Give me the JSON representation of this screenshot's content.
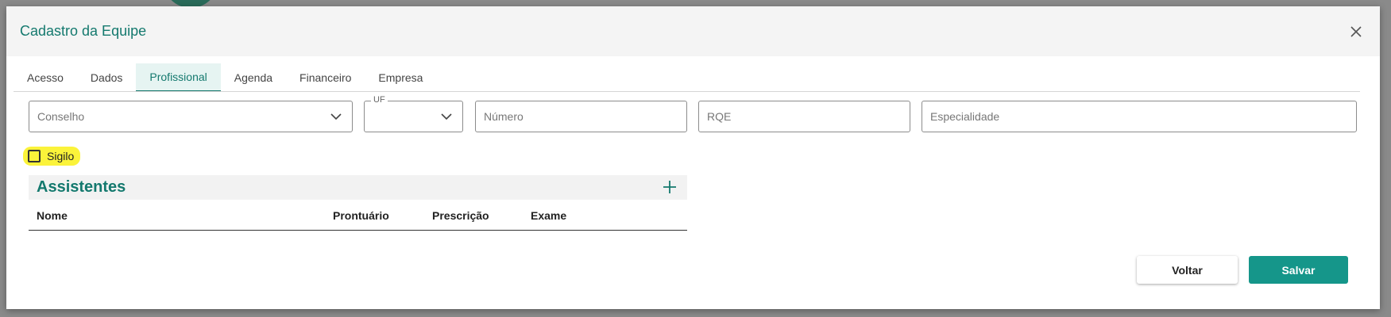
{
  "modal": {
    "title": "Cadastro da Equipe",
    "close_icon": "close-icon"
  },
  "tabs": [
    {
      "label": "Acesso",
      "active": false
    },
    {
      "label": "Dados",
      "active": false
    },
    {
      "label": "Profissional",
      "active": true
    },
    {
      "label": "Agenda",
      "active": false
    },
    {
      "label": "Financeiro",
      "active": false
    },
    {
      "label": "Empresa",
      "active": false
    }
  ],
  "form": {
    "conselho": {
      "placeholder": "Conselho",
      "value": ""
    },
    "uf": {
      "label": "UF",
      "value": ""
    },
    "numero": {
      "placeholder": "Número",
      "value": ""
    },
    "rqe": {
      "placeholder": "RQE",
      "value": ""
    },
    "especialidade": {
      "placeholder": "Especialidade",
      "value": ""
    },
    "sigilo": {
      "label": "Sigilo",
      "checked": false
    }
  },
  "assistentes": {
    "title": "Assistentes",
    "add_icon": "plus-icon",
    "columns": [
      "Nome",
      "Prontuário",
      "Prescrição",
      "Exame"
    ]
  },
  "actions": {
    "voltar": "Voltar",
    "salvar": "Salvar"
  },
  "colors": {
    "accent": "#14796e",
    "primary_button": "#15968a",
    "highlight": "#fbf33a"
  }
}
